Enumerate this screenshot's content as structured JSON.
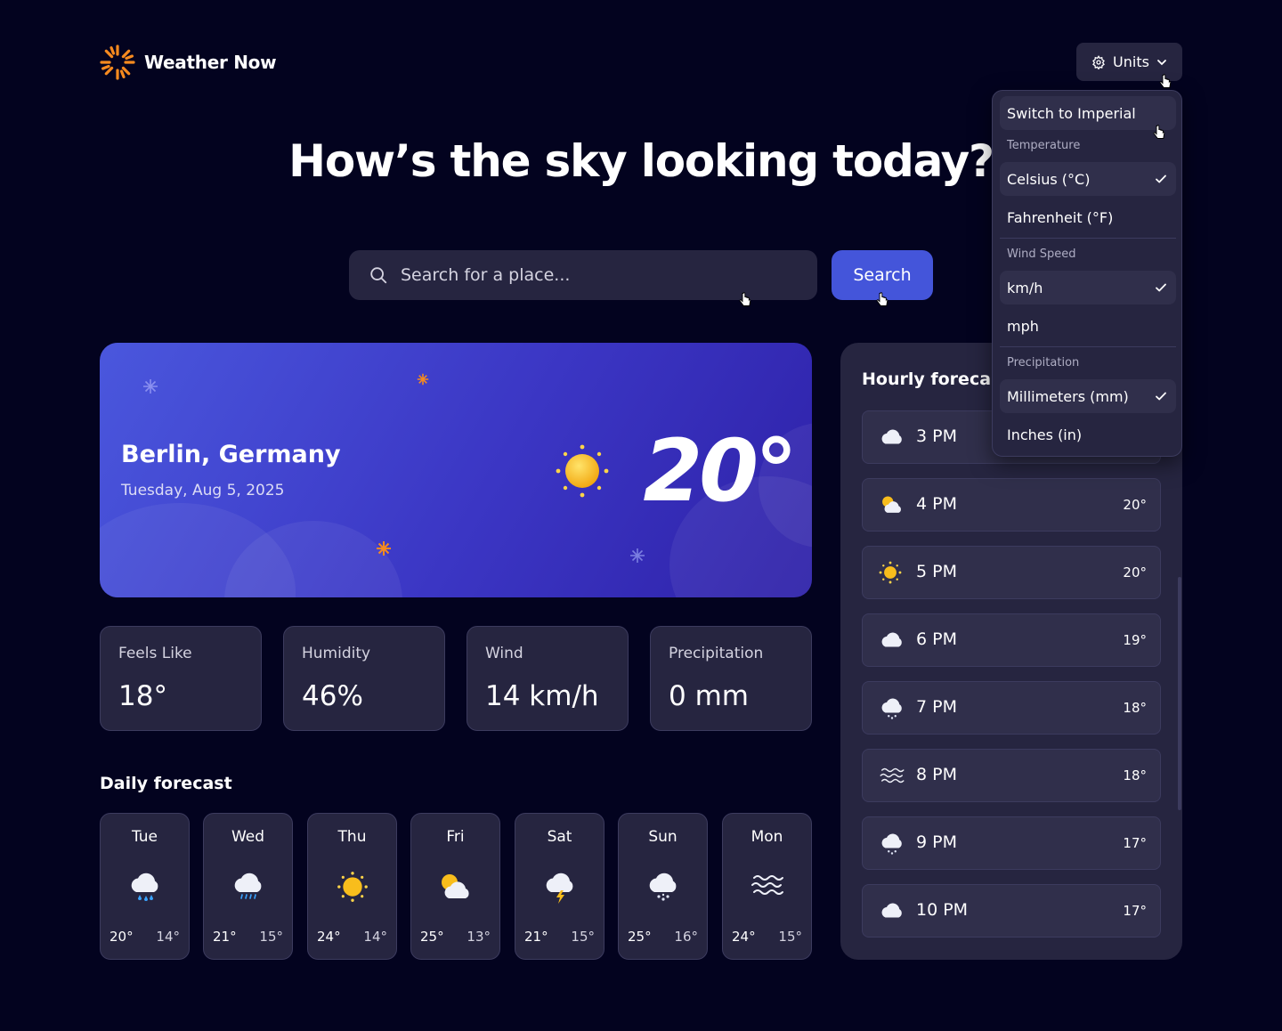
{
  "app": {
    "name": "Weather Now"
  },
  "header": {
    "units_label": "Units"
  },
  "hero": {
    "headline": "How’s the sky looking today?"
  },
  "search": {
    "placeholder": "Search for a place...",
    "button_label": "Search"
  },
  "current": {
    "location": "Berlin, Germany",
    "date": "Tuesday, Aug 5, 2025",
    "temperature": "20°",
    "icon": "sunny-icon"
  },
  "stats": [
    {
      "label": "Feels Like",
      "value": "18°"
    },
    {
      "label": "Humidity",
      "value": "46%"
    },
    {
      "label": "Wind",
      "value": "14 km/h"
    },
    {
      "label": "Precipitation",
      "value": "0 mm"
    }
  ],
  "daily": {
    "title": "Daily forecast",
    "days": [
      {
        "day": "Tue",
        "icon": "rain-icon",
        "high": "20°",
        "low": "14°"
      },
      {
        "day": "Wed",
        "icon": "drizzle-icon",
        "high": "21°",
        "low": "15°"
      },
      {
        "day": "Thu",
        "icon": "sunny-icon",
        "high": "24°",
        "low": "14°"
      },
      {
        "day": "Fri",
        "icon": "partly-cloudy-icon",
        "high": "25°",
        "low": "13°"
      },
      {
        "day": "Sat",
        "icon": "storm-icon",
        "high": "21°",
        "low": "15°"
      },
      {
        "day": "Sun",
        "icon": "snow-icon",
        "high": "25°",
        "low": "16°"
      },
      {
        "day": "Mon",
        "icon": "fog-icon",
        "high": "24°",
        "low": "15°"
      }
    ]
  },
  "hourly": {
    "title": "Hourly forecast",
    "hours": [
      {
        "time": "3 PM",
        "icon": "cloud-icon",
        "temp": ""
      },
      {
        "time": "4 PM",
        "icon": "partly-cloudy-icon",
        "temp": "20°"
      },
      {
        "time": "5 PM",
        "icon": "sunny-icon",
        "temp": "20°"
      },
      {
        "time": "6 PM",
        "icon": "cloud-icon",
        "temp": "19°"
      },
      {
        "time": "7 PM",
        "icon": "snow-icon",
        "temp": "18°"
      },
      {
        "time": "8 PM",
        "icon": "fog-icon",
        "temp": "18°"
      },
      {
        "time": "9 PM",
        "icon": "snow-icon",
        "temp": "17°"
      },
      {
        "time": "10 PM",
        "icon": "cloud-icon",
        "temp": "17°"
      }
    ]
  },
  "units_menu": {
    "switch_label": "Switch to Imperial",
    "temperature": {
      "heading": "Temperature",
      "options": [
        "Celsius (°C)",
        "Fahrenheit (°F)"
      ],
      "selected": 0
    },
    "wind": {
      "heading": "Wind Speed",
      "options": [
        "km/h",
        "mph"
      ],
      "selected": 0
    },
    "precipitation": {
      "heading": "Precipitation",
      "options": [
        "Millimeters (mm)",
        "Inches (in)"
      ],
      "selected": 0
    }
  },
  "colors": {
    "background": "#03031f",
    "surface": "#262540",
    "accent": "#4455da",
    "brand_orange": "#f68a1f"
  }
}
